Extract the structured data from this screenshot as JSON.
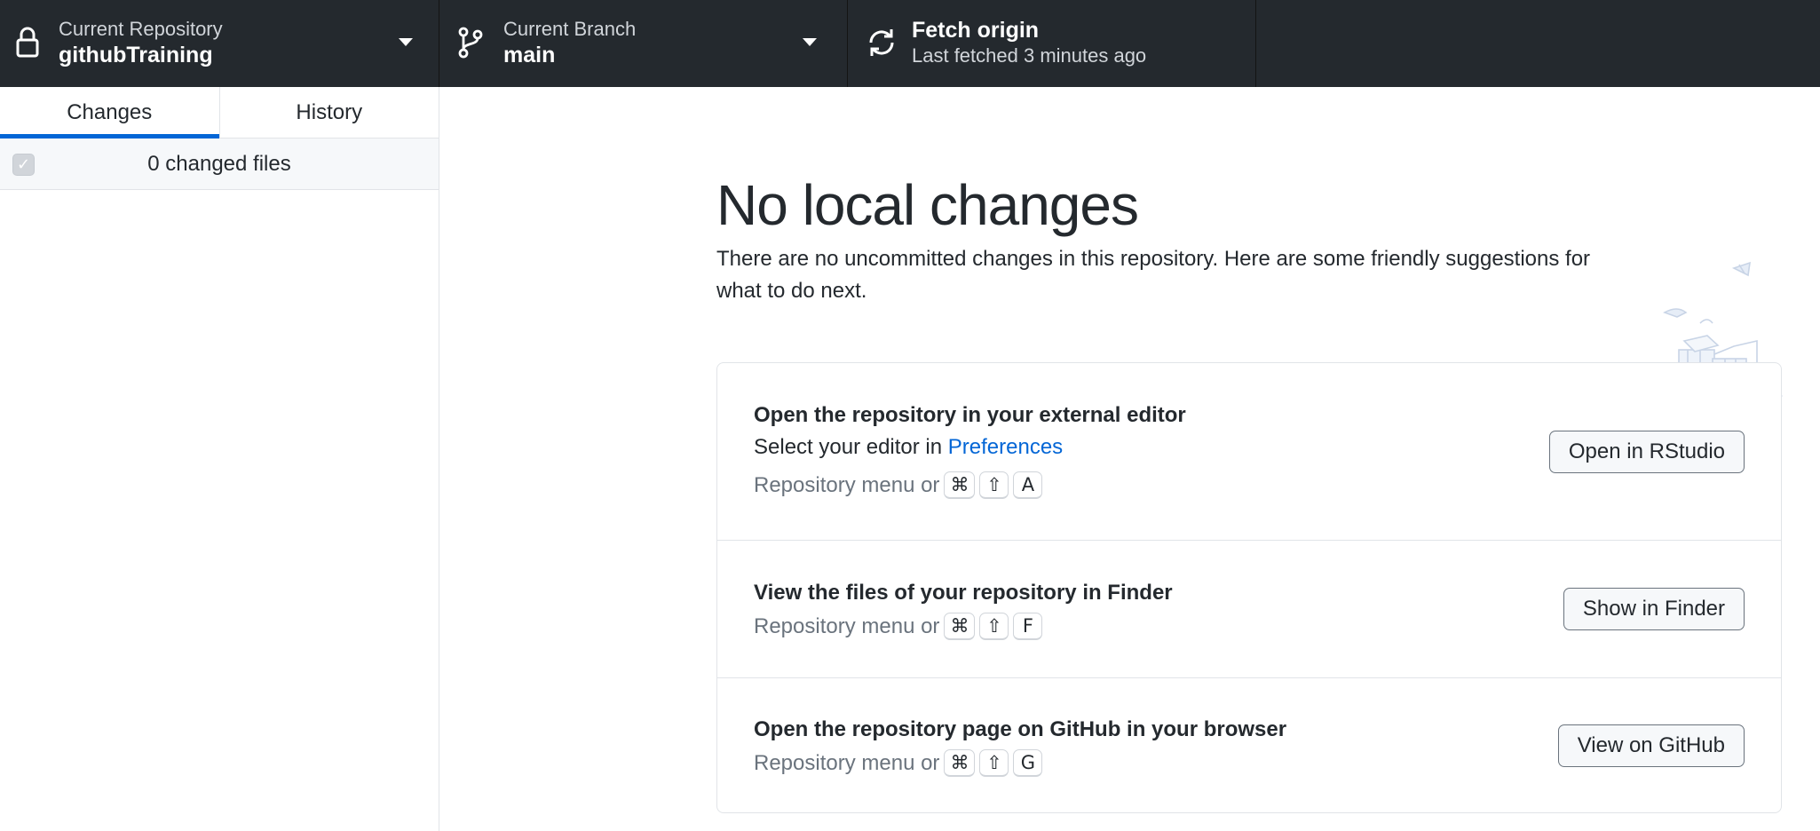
{
  "toolbar": {
    "repository": {
      "label": "Current Repository",
      "value": "githubTraining",
      "icon": "lock-icon"
    },
    "branch": {
      "label": "Current Branch",
      "value": "main",
      "icon": "git-branch-icon"
    },
    "fetch": {
      "title": "Fetch origin",
      "subtitle": "Last fetched 3 minutes ago",
      "icon": "sync-icon"
    }
  },
  "sidebar": {
    "tabs": [
      {
        "label": "Changes",
        "active": true
      },
      {
        "label": "History",
        "active": false
      }
    ],
    "changes_count": "0 changed files"
  },
  "main": {
    "title": "No local changes",
    "description": "There are no uncommitted changes in this repository. Here are some friendly suggestions for what to do next.",
    "suggestions": [
      {
        "title": "Open the repository in your external editor",
        "desc_prefix": "Select your editor in ",
        "desc_link": "Preferences",
        "shortcut_prefix": "Repository menu or",
        "keys": [
          "⌘",
          "⇧",
          "A"
        ],
        "button": "Open in RStudio"
      },
      {
        "title": "View the files of your repository in Finder",
        "shortcut_prefix": "Repository menu or",
        "keys": [
          "⌘",
          "⇧",
          "F"
        ],
        "button": "Show in Finder"
      },
      {
        "title": "Open the repository page on GitHub in your browser",
        "shortcut_prefix": "Repository menu or",
        "keys": [
          "⌘",
          "⇧",
          "G"
        ],
        "button": "View on GitHub"
      }
    ]
  },
  "colors": {
    "toolbar_bg": "#24292e",
    "accent": "#0366d6",
    "muted_text": "#6a737d"
  }
}
